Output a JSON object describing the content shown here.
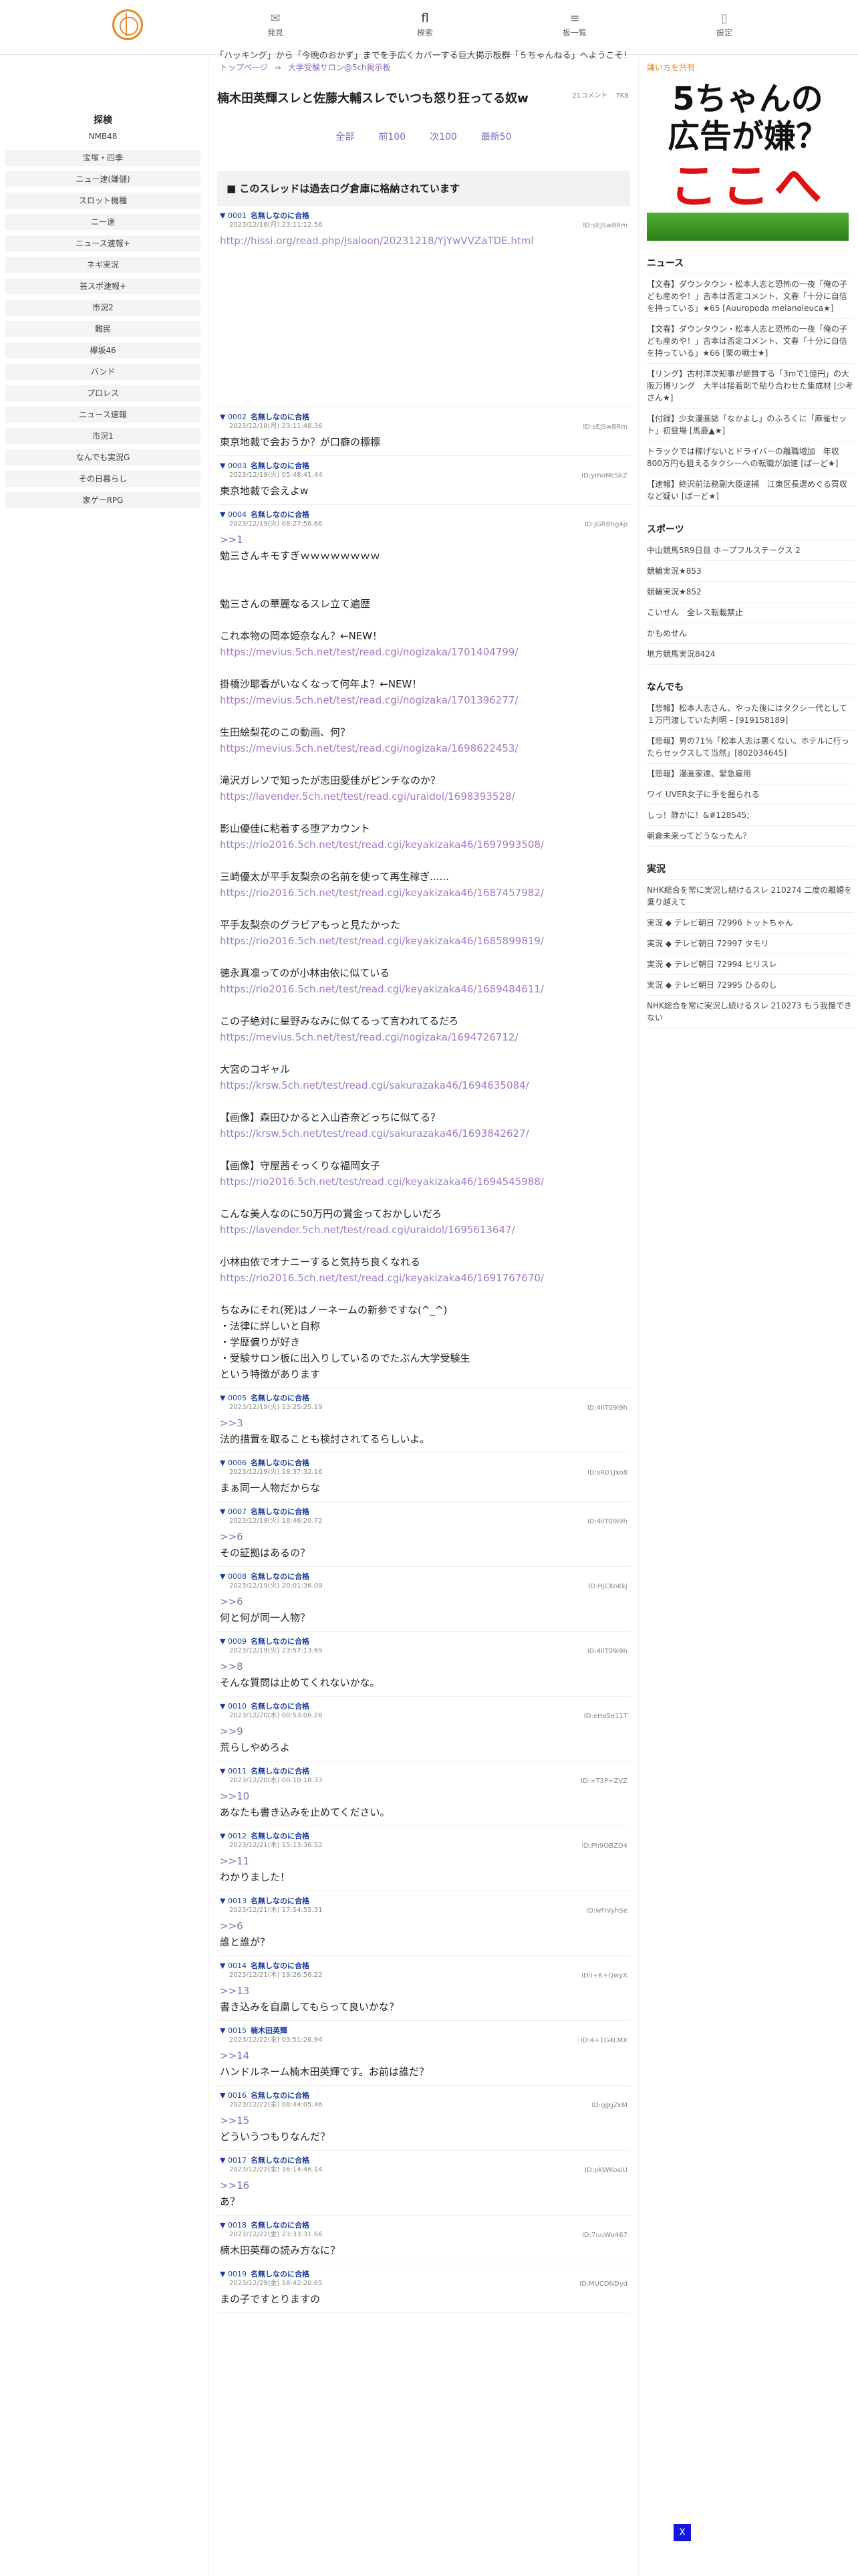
{
  "header": {
    "nav": [
      {
        "icon": "✉",
        "label": "発見"
      },
      {
        "icon": "fl",
        "label": "検索"
      },
      {
        "icon": "≡",
        "label": "板一覧"
      },
      {
        "icon": "▯",
        "label": "設定"
      }
    ],
    "marquee": "「ハッキング」から「今晩のおかず」までを手広くカバーする巨大掲示板群「５ちゃんねる」へようこそ！"
  },
  "sidebar": {
    "title": "探検",
    "items": [
      "NMB48",
      "宝塚・四季",
      "ニュー速(嫌儲)",
      "スロット機種",
      "ニー速",
      "ニュース速報+",
      "ネギ実況",
      "芸スポ速報+",
      "市況2",
      "難民",
      "欅坂46",
      "バンド",
      "プロレス",
      "ニュース速報",
      "市況1",
      "なんでも実況G",
      "その日暮らし",
      "家ゲーRPG"
    ]
  },
  "thread": {
    "breadcrumb": [
      "トップページ",
      "大学受験サロン@5ch掲示板"
    ],
    "comments": "21コメント",
    "size": "7KB",
    "title": "楠木田英輝スレと佐藤大輔スレでいつも怒り狂ってる奴w",
    "pager": [
      "全部",
      "前100",
      "次100",
      "最新50"
    ],
    "notice": "■ このスレッドは過去ログ倉庫に格納されています",
    "posts": [
      {
        "no": "0001",
        "name": "名無しなのに合格",
        "date": "2023/12/18(月) 23:11:12.56",
        "id": "ID:sEJSwBRm",
        "lines": [
          [
            "lnk",
            "http://hissi.org/read.php/jsaloon/20231218/YjYwVVZaTDE.html"
          ]
        ]
      },
      {
        "no": "0002",
        "name": "名無しなのに合格",
        "date": "2023/12/18(月) 23:11:48.36",
        "id": "ID:sEJSwBRm",
        "lines": [
          [
            "t",
            "東京地裁で会おうか？が口癖の標標"
          ]
        ]
      },
      {
        "no": "0003",
        "name": "名無しなのに合格",
        "date": "2023/12/19(火) 05:48:41.44",
        "id": "ID:ymoMcSkZ",
        "lines": [
          [
            "t",
            "東京地裁で会えよw"
          ]
        ]
      },
      {
        "no": "0004",
        "name": "名無しなのに合格",
        "date": "2023/12/19(火) 08:27:56.66",
        "id": "ID:JGRBhg4p",
        "lines": [
          [
            "anc",
            ">>1"
          ],
          [
            "t",
            "勉三さんキモすぎｗｗｗｗｗｗｗｗ"
          ],
          [
            "t",
            ""
          ],
          [
            "t",
            ""
          ],
          [
            "t",
            "勉三さんの華麗なるスレ立て遍歴"
          ],
          [
            "t",
            ""
          ],
          [
            "t",
            "これ本物の岡本姫奈なん？←NEW！"
          ],
          [
            "lnk",
            "https://mevius.5ch.net/test/read.cgi/nogizaka/1701404799/"
          ],
          [
            "t",
            ""
          ],
          [
            "t",
            "掛橋沙耶香がいなくなって何年よ？←NEW！"
          ],
          [
            "lnk",
            "https://mevius.5ch.net/test/read.cgi/nogizaka/1701396277/"
          ],
          [
            "t",
            ""
          ],
          [
            "t",
            "生田絵梨花のこの動画、何？"
          ],
          [
            "lnk",
            "https://mevius.5ch.net/test/read.cgi/nogizaka/1698622453/"
          ],
          [
            "t",
            ""
          ],
          [
            "t",
            "滝沢ガレソで知ったが志田愛佳がピンチなのか？"
          ],
          [
            "lnk",
            "https://lavender.5ch.net/test/read.cgi/uraidol/1698393528/"
          ],
          [
            "t",
            ""
          ],
          [
            "t",
            "影山優佳に粘着する堕アカウント"
          ],
          [
            "lnk",
            "https://rio2016.5ch.net/test/read.cgi/keyakizaka46/1697993508/"
          ],
          [
            "t",
            ""
          ],
          [
            "t",
            "三崎優太が平手友梨奈の名前を使って再生稼ぎ......"
          ],
          [
            "lnk",
            "https://rio2016.5ch.net/test/read.cgi/keyakizaka46/1687457982/"
          ],
          [
            "t",
            ""
          ],
          [
            "t",
            "平手友梨奈のグラビアもっと見たかった"
          ],
          [
            "lnk",
            "https://rio2016.5ch.net/test/read.cgi/keyakizaka46/1685899819/"
          ],
          [
            "t",
            ""
          ],
          [
            "t",
            "徳永真凛ってのが小林由依に似ている"
          ],
          [
            "lnk",
            "https://rio2016.5ch.net/test/read.cgi/keyakizaka46/1689484611/"
          ],
          [
            "t",
            ""
          ],
          [
            "t",
            "この子絶対に星野みなみに似てるって言われてるだろ"
          ],
          [
            "lnk",
            "https://mevius.5ch.net/test/read.cgi/nogizaka/1694726712/"
          ],
          [
            "t",
            ""
          ],
          [
            "t",
            "大宮のコギャル"
          ],
          [
            "lnk",
            "https://krsw.5ch.net/test/read.cgi/sakurazaka46/1694635084/"
          ],
          [
            "t",
            ""
          ],
          [
            "t",
            "【画像】森田ひかると入山杏奈どっちに似てる？"
          ],
          [
            "lnk",
            "https://krsw.5ch.net/test/read.cgi/sakurazaka46/1693842627/"
          ],
          [
            "t",
            ""
          ],
          [
            "t",
            "【画像】守屋茜そっくりな福岡女子"
          ],
          [
            "lnk",
            "https://rio2016.5ch.net/test/read.cgi/keyakizaka46/1694545988/"
          ],
          [
            "t",
            ""
          ],
          [
            "t",
            "こんな美人なのに50万円の賞金っておかしいだろ"
          ],
          [
            "lnk",
            "https://lavender.5ch.net/test/read.cgi/uraidol/1695613647/"
          ],
          [
            "t",
            ""
          ],
          [
            "t",
            "小林由依でオナニーすると気持ち良くなれる"
          ],
          [
            "lnk",
            "https://rio2016.5ch.net/test/read.cgi/keyakizaka46/1691767670/"
          ],
          [
            "t",
            ""
          ],
          [
            "t",
            "ちなみにそれ(死)はノーネームの新参ですな(^_^)"
          ],
          [
            "t",
            "・法律に詳しいと自称"
          ],
          [
            "t",
            "・学歴偏りが好き"
          ],
          [
            "t",
            "・受験サロン板に出入りしているのでたぶん大学受験生"
          ],
          [
            "t",
            "という特徴があります"
          ]
        ]
      },
      {
        "no": "0005",
        "name": "名無しなのに合格",
        "date": "2023/12/19(火) 13:25:25.19",
        "id": "ID:4ilT09i9h",
        "lines": [
          [
            "anc",
            ">>3"
          ],
          [
            "t",
            "法的措置を取ることも検討されてるらしいよ。"
          ]
        ]
      },
      {
        "no": "0006",
        "name": "名無しなのに合格",
        "date": "2023/12/19(火) 18:37:32.16",
        "id": "ID:sR01Jxo8",
        "lines": [
          [
            "t",
            "まぁ同一人物だからな"
          ]
        ]
      },
      {
        "no": "0007",
        "name": "名無しなのに合格",
        "date": "2023/12/19(火) 18:46:20.72",
        "id": "ID:4ilT09i9h",
        "lines": [
          [
            "anc",
            ">>6"
          ],
          [
            "t",
            "その証拠はあるの？"
          ]
        ]
      },
      {
        "no": "0008",
        "name": "名無しなのに合格",
        "date": "2023/12/19(火) 20:01:36.09",
        "id": "ID:HjCKoKkj",
        "lines": [
          [
            "anc",
            ">>6"
          ],
          [
            "t",
            "何と何が同一人物？"
          ]
        ]
      },
      {
        "no": "0009",
        "name": "名無しなのに合格",
        "date": "2023/12/19(火) 23:57:13.69",
        "id": "ID:4ilT09i9h",
        "lines": [
          [
            "anc",
            ">>8"
          ],
          [
            "t",
            "そんな質問は止めてくれないかな。"
          ]
        ]
      },
      {
        "no": "0010",
        "name": "名無しなのに合格",
        "date": "2023/12/20(水) 00:53:06.28",
        "id": "ID:eHe5e11T",
        "lines": [
          [
            "anc",
            ">>9"
          ],
          [
            "t",
            "荒らしやめろよ"
          ]
        ]
      },
      {
        "no": "0011",
        "name": "名無しなのに合格",
        "date": "2023/12/20(水) 00:10:18.33",
        "id": "ID:+T3P+ZVZ",
        "lines": [
          [
            "anc",
            ">>10"
          ],
          [
            "t",
            "あなたも書き込みを止めてください。"
          ]
        ]
      },
      {
        "no": "0012",
        "name": "名無しなのに合格",
        "date": "2023/12/21(木) 15:13:36.52",
        "id": "ID:Ph9OBZD4",
        "lines": [
          [
            "anc",
            ">>11"
          ],
          [
            "t",
            "わかりました！"
          ]
        ]
      },
      {
        "no": "0013",
        "name": "名無しなのに合格",
        "date": "2023/12/21(木) 17:54:55.31",
        "id": "ID:wFnlyhSe",
        "lines": [
          [
            "anc",
            ">>6"
          ],
          [
            "t",
            "誰と誰が？"
          ]
        ]
      },
      {
        "no": "0014",
        "name": "名無しなのに合格",
        "date": "2023/12/21(木) 19:26:56.22",
        "id": "ID:i+K+QwyX",
        "lines": [
          [
            "anc",
            ">>13"
          ],
          [
            "t",
            "書き込みを自粛してもらって良いかな？"
          ]
        ]
      },
      {
        "no": "0015",
        "name": "楠木田英輝",
        "date": "2023/12/22(金) 03:51:26.94",
        "id": "ID:4+1G4LMX",
        "lines": [
          [
            "anc",
            ">>14"
          ],
          [
            "t",
            "ハンドルネーム楠木田英輝です。お前は誰だ？"
          ]
        ]
      },
      {
        "no": "0016",
        "name": "名無しなのに合格",
        "date": "2023/12/22(金) 08:44:05.46",
        "id": "ID:gjJgZkM",
        "lines": [
          [
            "anc",
            ">>15"
          ],
          [
            "t",
            "どういうつもりなんだ？"
          ]
        ]
      },
      {
        "no": "0017",
        "name": "名無しなのに合格",
        "date": "2023/12/22(金) 16:14:46.14",
        "id": "ID:pKWKosiU",
        "lines": [
          [
            "anc",
            ">>16"
          ],
          [
            "t",
            "あ？"
          ]
        ]
      },
      {
        "no": "0018",
        "name": "名無しなのに合格",
        "date": "2023/12/22(金) 23:33:31.66",
        "id": "ID:7uuWu467",
        "lines": [
          [
            "t",
            "楠木田英輝の読み方なに？"
          ]
        ]
      },
      {
        "no": "0019",
        "name": "名無しなのに合格",
        "date": "2023/12/29(金) 18:42:20.65",
        "id": "ID:MUCDNDyd",
        "lines": [
          [
            "t",
            "まの子ですとりますの"
          ]
        ]
      }
    ]
  },
  "right": {
    "ad_label": "嫌い方を共有",
    "ad_line1": "5ちゃんの\n広告が嫌？",
    "ad_line2": "ここへ",
    "sections": [
      {
        "title": "ニュース",
        "items": [
          "【文春】ダウンタウン・松本人志と恐怖の一夜「俺の子ども産めや！」吉本は否定コメント、文春「十分に自信を持っている」★65 [Auuropoda melanoleuca★]",
          "【文春】ダウンタウン・松本人志と恐怖の一夜「俺の子ども産めや！」吉本は否定コメント、文春「十分に自信を持っている」★66 [栗の戦士★]",
          "【リング】古村洋次知事が絶賛する「3mで1億円」の大阪万博リング　大半は接着剤で貼り合わせた集成材 [少考さん★]",
          "【付録】少女漫画誌「なかよし」のふろくに「麻雀セット」初登場 [馬鹿▲★]",
          "トラックでは稼げないとドライバーの離職増加　年収800万円も狙えるタクシーへの転職が加速 [ぱーど★]",
          "【速報】終沢前法務副大臣逮捕　江東区長選めぐる買収など疑い [ぱーど★]"
        ]
      },
      {
        "title": "スポーツ",
        "items": [
          "中山競馬5R9日目 ホープフルステークス 2",
          "競輪実況★853",
          "競輪実況★852",
          "こいせん　全レス転載禁止",
          "かもめせん",
          "地方競馬実況8424"
        ]
      },
      {
        "title": "なんでも",
        "items": [
          "【悲報】松本人志さん、やった後にはタクシー代として１万円渡していた判明 – [919158189]",
          "【悲報】男の71%「松本人志は悪くない。ホテルに行ったらセックスして当然」[802034645]",
          "【悲報】漫画家達、緊急雇用",
          "ワイ UVER女子に手を握られる",
          "しっ！静かに！&#128545;",
          "朝倉未来ってどうなったん？"
        ]
      },
      {
        "title": "実況",
        "items": [
          "NHK総合を常に実況し続けるスレ 210274 二度の離婚を乗り越えて",
          "実況 ◆ テレビ朝日 72996 トットちゃん",
          "実況 ◆ テレビ朝日 72997 タモリ",
          "実況 ◆ テレビ朝日 72994 ヒリスレ",
          "実況 ◆ テレビ朝日 72995 ひるのし",
          "NHK総合を常に実況し続けるスレ 210273 もう我慢できない"
        ]
      }
    ]
  },
  "scrolltop": "X"
}
